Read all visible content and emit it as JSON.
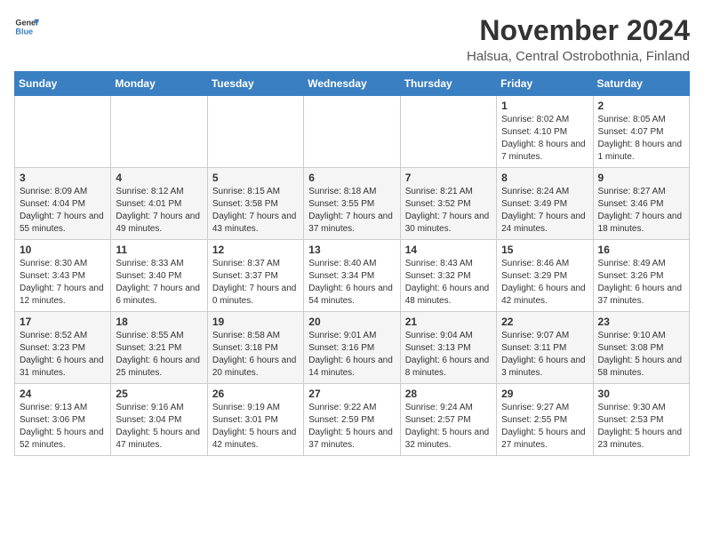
{
  "header": {
    "logo_general": "General",
    "logo_blue": "Blue",
    "month_title": "November 2024",
    "location": "Halsua, Central Ostrobothnia, Finland"
  },
  "days_of_week": [
    "Sunday",
    "Monday",
    "Tuesday",
    "Wednesday",
    "Thursday",
    "Friday",
    "Saturday"
  ],
  "weeks": [
    {
      "days": [
        {
          "number": "",
          "info": ""
        },
        {
          "number": "",
          "info": ""
        },
        {
          "number": "",
          "info": ""
        },
        {
          "number": "",
          "info": ""
        },
        {
          "number": "",
          "info": ""
        },
        {
          "number": "1",
          "info": "Sunrise: 8:02 AM\nSunset: 4:10 PM\nDaylight: 8 hours and 7 minutes."
        },
        {
          "number": "2",
          "info": "Sunrise: 8:05 AM\nSunset: 4:07 PM\nDaylight: 8 hours and 1 minute."
        }
      ]
    },
    {
      "days": [
        {
          "number": "3",
          "info": "Sunrise: 8:09 AM\nSunset: 4:04 PM\nDaylight: 7 hours and 55 minutes."
        },
        {
          "number": "4",
          "info": "Sunrise: 8:12 AM\nSunset: 4:01 PM\nDaylight: 7 hours and 49 minutes."
        },
        {
          "number": "5",
          "info": "Sunrise: 8:15 AM\nSunset: 3:58 PM\nDaylight: 7 hours and 43 minutes."
        },
        {
          "number": "6",
          "info": "Sunrise: 8:18 AM\nSunset: 3:55 PM\nDaylight: 7 hours and 37 minutes."
        },
        {
          "number": "7",
          "info": "Sunrise: 8:21 AM\nSunset: 3:52 PM\nDaylight: 7 hours and 30 minutes."
        },
        {
          "number": "8",
          "info": "Sunrise: 8:24 AM\nSunset: 3:49 PM\nDaylight: 7 hours and 24 minutes."
        },
        {
          "number": "9",
          "info": "Sunrise: 8:27 AM\nSunset: 3:46 PM\nDaylight: 7 hours and 18 minutes."
        }
      ]
    },
    {
      "days": [
        {
          "number": "10",
          "info": "Sunrise: 8:30 AM\nSunset: 3:43 PM\nDaylight: 7 hours and 12 minutes."
        },
        {
          "number": "11",
          "info": "Sunrise: 8:33 AM\nSunset: 3:40 PM\nDaylight: 7 hours and 6 minutes."
        },
        {
          "number": "12",
          "info": "Sunrise: 8:37 AM\nSunset: 3:37 PM\nDaylight: 7 hours and 0 minutes."
        },
        {
          "number": "13",
          "info": "Sunrise: 8:40 AM\nSunset: 3:34 PM\nDaylight: 6 hours and 54 minutes."
        },
        {
          "number": "14",
          "info": "Sunrise: 8:43 AM\nSunset: 3:32 PM\nDaylight: 6 hours and 48 minutes."
        },
        {
          "number": "15",
          "info": "Sunrise: 8:46 AM\nSunset: 3:29 PM\nDaylight: 6 hours and 42 minutes."
        },
        {
          "number": "16",
          "info": "Sunrise: 8:49 AM\nSunset: 3:26 PM\nDaylight: 6 hours and 37 minutes."
        }
      ]
    },
    {
      "days": [
        {
          "number": "17",
          "info": "Sunrise: 8:52 AM\nSunset: 3:23 PM\nDaylight: 6 hours and 31 minutes."
        },
        {
          "number": "18",
          "info": "Sunrise: 8:55 AM\nSunset: 3:21 PM\nDaylight: 6 hours and 25 minutes."
        },
        {
          "number": "19",
          "info": "Sunrise: 8:58 AM\nSunset: 3:18 PM\nDaylight: 6 hours and 20 minutes."
        },
        {
          "number": "20",
          "info": "Sunrise: 9:01 AM\nSunset: 3:16 PM\nDaylight: 6 hours and 14 minutes."
        },
        {
          "number": "21",
          "info": "Sunrise: 9:04 AM\nSunset: 3:13 PM\nDaylight: 6 hours and 8 minutes."
        },
        {
          "number": "22",
          "info": "Sunrise: 9:07 AM\nSunset: 3:11 PM\nDaylight: 6 hours and 3 minutes."
        },
        {
          "number": "23",
          "info": "Sunrise: 9:10 AM\nSunset: 3:08 PM\nDaylight: 5 hours and 58 minutes."
        }
      ]
    },
    {
      "days": [
        {
          "number": "24",
          "info": "Sunrise: 9:13 AM\nSunset: 3:06 PM\nDaylight: 5 hours and 52 minutes."
        },
        {
          "number": "25",
          "info": "Sunrise: 9:16 AM\nSunset: 3:04 PM\nDaylight: 5 hours and 47 minutes."
        },
        {
          "number": "26",
          "info": "Sunrise: 9:19 AM\nSunset: 3:01 PM\nDaylight: 5 hours and 42 minutes."
        },
        {
          "number": "27",
          "info": "Sunrise: 9:22 AM\nSunset: 2:59 PM\nDaylight: 5 hours and 37 minutes."
        },
        {
          "number": "28",
          "info": "Sunrise: 9:24 AM\nSunset: 2:57 PM\nDaylight: 5 hours and 32 minutes."
        },
        {
          "number": "29",
          "info": "Sunrise: 9:27 AM\nSunset: 2:55 PM\nDaylight: 5 hours and 27 minutes."
        },
        {
          "number": "30",
          "info": "Sunrise: 9:30 AM\nSunset: 2:53 PM\nDaylight: 5 hours and 23 minutes."
        }
      ]
    }
  ]
}
